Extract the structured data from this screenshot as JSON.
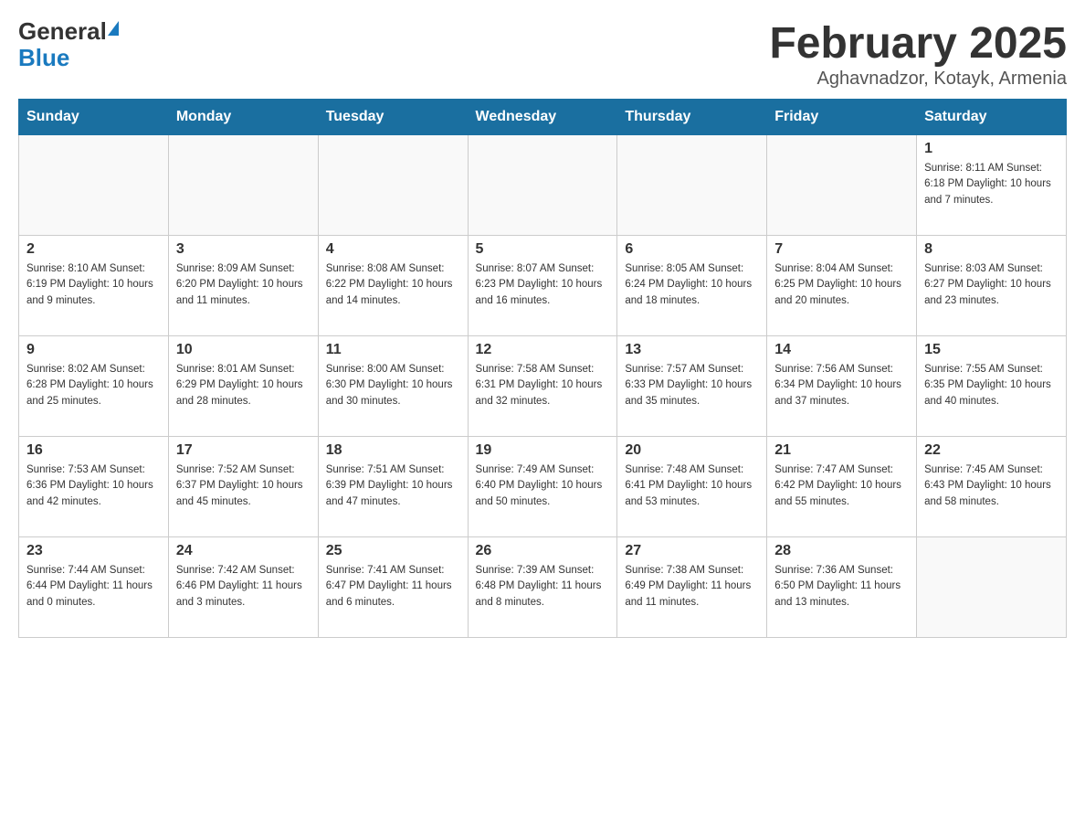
{
  "header": {
    "title": "February 2025",
    "subtitle": "Aghavnadzor, Kotayk, Armenia",
    "logo_general": "General",
    "logo_blue": "Blue"
  },
  "days_of_week": [
    "Sunday",
    "Monday",
    "Tuesday",
    "Wednesday",
    "Thursday",
    "Friday",
    "Saturday"
  ],
  "weeks": [
    [
      {
        "day": "",
        "info": ""
      },
      {
        "day": "",
        "info": ""
      },
      {
        "day": "",
        "info": ""
      },
      {
        "day": "",
        "info": ""
      },
      {
        "day": "",
        "info": ""
      },
      {
        "day": "",
        "info": ""
      },
      {
        "day": "1",
        "info": "Sunrise: 8:11 AM\nSunset: 6:18 PM\nDaylight: 10 hours and 7 minutes."
      }
    ],
    [
      {
        "day": "2",
        "info": "Sunrise: 8:10 AM\nSunset: 6:19 PM\nDaylight: 10 hours and 9 minutes."
      },
      {
        "day": "3",
        "info": "Sunrise: 8:09 AM\nSunset: 6:20 PM\nDaylight: 10 hours and 11 minutes."
      },
      {
        "day": "4",
        "info": "Sunrise: 8:08 AM\nSunset: 6:22 PM\nDaylight: 10 hours and 14 minutes."
      },
      {
        "day": "5",
        "info": "Sunrise: 8:07 AM\nSunset: 6:23 PM\nDaylight: 10 hours and 16 minutes."
      },
      {
        "day": "6",
        "info": "Sunrise: 8:05 AM\nSunset: 6:24 PM\nDaylight: 10 hours and 18 minutes."
      },
      {
        "day": "7",
        "info": "Sunrise: 8:04 AM\nSunset: 6:25 PM\nDaylight: 10 hours and 20 minutes."
      },
      {
        "day": "8",
        "info": "Sunrise: 8:03 AM\nSunset: 6:27 PM\nDaylight: 10 hours and 23 minutes."
      }
    ],
    [
      {
        "day": "9",
        "info": "Sunrise: 8:02 AM\nSunset: 6:28 PM\nDaylight: 10 hours and 25 minutes."
      },
      {
        "day": "10",
        "info": "Sunrise: 8:01 AM\nSunset: 6:29 PM\nDaylight: 10 hours and 28 minutes."
      },
      {
        "day": "11",
        "info": "Sunrise: 8:00 AM\nSunset: 6:30 PM\nDaylight: 10 hours and 30 minutes."
      },
      {
        "day": "12",
        "info": "Sunrise: 7:58 AM\nSunset: 6:31 PM\nDaylight: 10 hours and 32 minutes."
      },
      {
        "day": "13",
        "info": "Sunrise: 7:57 AM\nSunset: 6:33 PM\nDaylight: 10 hours and 35 minutes."
      },
      {
        "day": "14",
        "info": "Sunrise: 7:56 AM\nSunset: 6:34 PM\nDaylight: 10 hours and 37 minutes."
      },
      {
        "day": "15",
        "info": "Sunrise: 7:55 AM\nSunset: 6:35 PM\nDaylight: 10 hours and 40 minutes."
      }
    ],
    [
      {
        "day": "16",
        "info": "Sunrise: 7:53 AM\nSunset: 6:36 PM\nDaylight: 10 hours and 42 minutes."
      },
      {
        "day": "17",
        "info": "Sunrise: 7:52 AM\nSunset: 6:37 PM\nDaylight: 10 hours and 45 minutes."
      },
      {
        "day": "18",
        "info": "Sunrise: 7:51 AM\nSunset: 6:39 PM\nDaylight: 10 hours and 47 minutes."
      },
      {
        "day": "19",
        "info": "Sunrise: 7:49 AM\nSunset: 6:40 PM\nDaylight: 10 hours and 50 minutes."
      },
      {
        "day": "20",
        "info": "Sunrise: 7:48 AM\nSunset: 6:41 PM\nDaylight: 10 hours and 53 minutes."
      },
      {
        "day": "21",
        "info": "Sunrise: 7:47 AM\nSunset: 6:42 PM\nDaylight: 10 hours and 55 minutes."
      },
      {
        "day": "22",
        "info": "Sunrise: 7:45 AM\nSunset: 6:43 PM\nDaylight: 10 hours and 58 minutes."
      }
    ],
    [
      {
        "day": "23",
        "info": "Sunrise: 7:44 AM\nSunset: 6:44 PM\nDaylight: 11 hours and 0 minutes."
      },
      {
        "day": "24",
        "info": "Sunrise: 7:42 AM\nSunset: 6:46 PM\nDaylight: 11 hours and 3 minutes."
      },
      {
        "day": "25",
        "info": "Sunrise: 7:41 AM\nSunset: 6:47 PM\nDaylight: 11 hours and 6 minutes."
      },
      {
        "day": "26",
        "info": "Sunrise: 7:39 AM\nSunset: 6:48 PM\nDaylight: 11 hours and 8 minutes."
      },
      {
        "day": "27",
        "info": "Sunrise: 7:38 AM\nSunset: 6:49 PM\nDaylight: 11 hours and 11 minutes."
      },
      {
        "day": "28",
        "info": "Sunrise: 7:36 AM\nSunset: 6:50 PM\nDaylight: 11 hours and 13 minutes."
      },
      {
        "day": "",
        "info": ""
      }
    ]
  ]
}
